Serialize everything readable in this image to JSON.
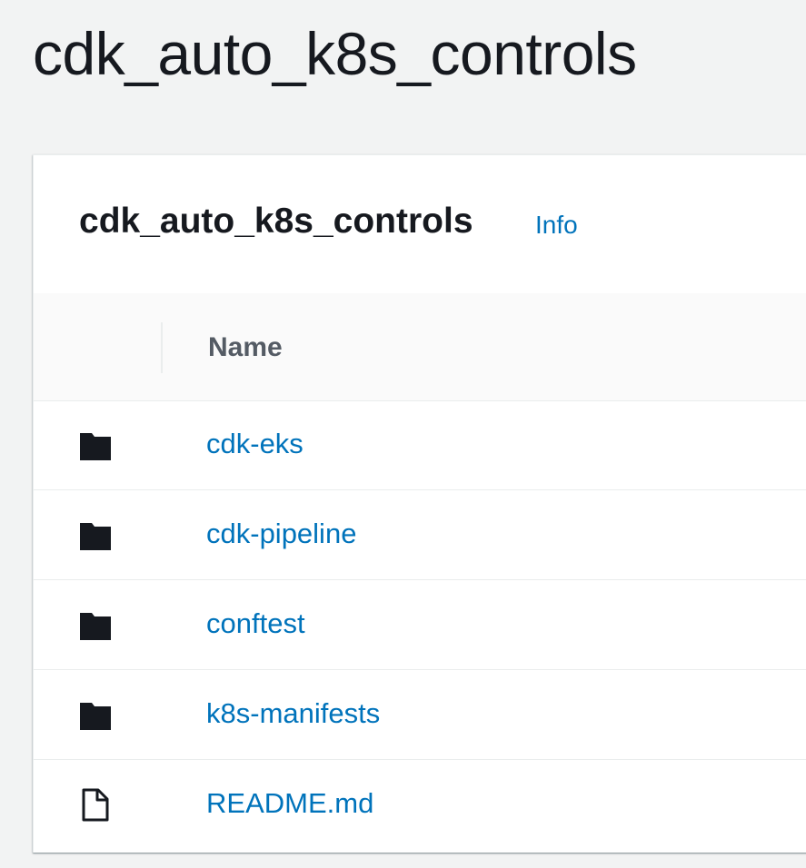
{
  "page": {
    "title": "cdk_auto_k8s_controls"
  },
  "panel": {
    "title": "cdk_auto_k8s_controls",
    "info_label": "Info"
  },
  "table": {
    "columns": [
      "Name"
    ],
    "rows": [
      {
        "name": "cdk-eks",
        "icon": "folder-icon"
      },
      {
        "name": "cdk-pipeline",
        "icon": "folder-icon"
      },
      {
        "name": "conftest",
        "icon": "folder-icon"
      },
      {
        "name": "k8s-manifests",
        "icon": "folder-icon"
      },
      {
        "name": "README.md",
        "icon": "file-icon"
      }
    ]
  },
  "colors": {
    "link": "#0073bb",
    "text": "#16191f",
    "header_text": "#545b64",
    "background": "#f2f3f3"
  }
}
